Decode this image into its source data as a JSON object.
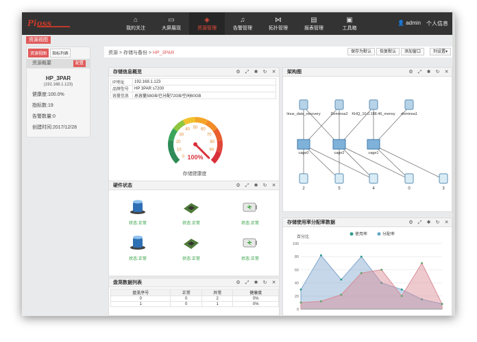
{
  "logo": {
    "text": "Pioss"
  },
  "nav": {
    "items": [
      {
        "label": "我的关注",
        "icon": "home-icon",
        "glyph": "⌂"
      },
      {
        "label": "大屏展现",
        "icon": "monitor-icon",
        "glyph": "▭"
      },
      {
        "label": "资源管理",
        "icon": "cube-icon",
        "glyph": "◈"
      },
      {
        "label": "告警管理",
        "icon": "bell-icon",
        "glyph": "♫"
      },
      {
        "label": "拓扑管理",
        "icon": "topology-icon",
        "glyph": "⋈"
      },
      {
        "label": "报表管理",
        "icon": "report-icon",
        "glyph": "▤"
      },
      {
        "label": "工具箱",
        "icon": "toolbox-icon",
        "glyph": "▣"
      }
    ],
    "active_index": 2
  },
  "user": {
    "name": "admin",
    "info_label": "个人信息"
  },
  "main_tab": "资源视图",
  "left_panel": {
    "tabs": [
      "资源视图",
      "指标列表"
    ],
    "heading": "资源概要",
    "badge": "配置",
    "name": "HP_3PAR",
    "ip": "(192.168.1.123)",
    "health": "健康度:100.0%",
    "metrics": "指标数:19",
    "alarms": "告警数量:0",
    "created": "创建时间:2017/12/28"
  },
  "breadcrumb": {
    "root": "资源",
    "sep1": " > ",
    "mid": "存储与备份",
    "sep2": " > ",
    "current": "HP_3PAR"
  },
  "toolbar": {
    "save_default": "保存为默认",
    "restore_default": "恢复默认",
    "add_window": "添加窗口",
    "columns": "列设置▾"
  },
  "storage_info": {
    "title": "存储信息概览",
    "rows": [
      {
        "k": "IP地址",
        "v": "192.168.1.123"
      },
      {
        "k": "品牌型号",
        "v": "HP 3PAR s7200"
      },
      {
        "k": "容量信息",
        "v": "总容量58GB/已分配72GB/空闲60GB"
      }
    ],
    "gauge": {
      "value": 100,
      "value_text": "100%",
      "label": "存储健康度",
      "ticks": [
        "0",
        "10",
        "20",
        "30",
        "40",
        "50",
        "60",
        "70",
        "80",
        "90"
      ]
    }
  },
  "hardware": {
    "title": "硬件状态",
    "items": [
      {
        "name": "controller-status-icon",
        "status": "状态:正常"
      },
      {
        "name": "board-status-icon",
        "status": "状态:正常"
      },
      {
        "name": "battery-status-icon",
        "status": "状态:正常"
      },
      {
        "name": "controller-status-icon",
        "status": "状态:正常"
      },
      {
        "name": "board-status-icon",
        "status": "状态:正常"
      },
      {
        "name": "battery-status-icon",
        "status": "状态:正常"
      }
    ]
  },
  "disk_table": {
    "title": "盘笼数据列表",
    "headers": [
      "盘笼序号",
      "正常",
      "异常",
      "健康度"
    ],
    "rows": [
      [
        "0",
        "0",
        "2",
        "0%"
      ],
      [
        "1",
        "0",
        "1",
        "0%"
      ]
    ]
  },
  "topology": {
    "title": "架构图",
    "hosts": [
      "linux_data_recovery",
      "Dominoa2",
      "KHQ_10.0.188.46_mensy",
      "dominoa1"
    ],
    "cages": [
      "cage0",
      "cage2",
      "cage1"
    ],
    "disks": [
      "2",
      "5",
      "4",
      "0",
      "3"
    ]
  },
  "usage_chart": {
    "title": "存储使用率分配率数据",
    "unit": "百分比"
  },
  "chart_data": {
    "type": "area",
    "title": "",
    "ylabel": "百分比",
    "ylim": [
      0,
      100
    ],
    "yticks": [
      "0",
      "20",
      "40",
      "60",
      "80",
      "100"
    ],
    "x": [
      0,
      1,
      2,
      3,
      4,
      5,
      6,
      7
    ],
    "series": [
      {
        "name": "使用率",
        "color": "#7fa6cf",
        "values": [
          30,
          82,
          45,
          80,
          40,
          30,
          15,
          8
        ]
      },
      {
        "name": "分配率",
        "color": "#d98a95",
        "values": [
          10,
          12,
          22,
          55,
          60,
          20,
          70,
          8
        ]
      }
    ]
  }
}
